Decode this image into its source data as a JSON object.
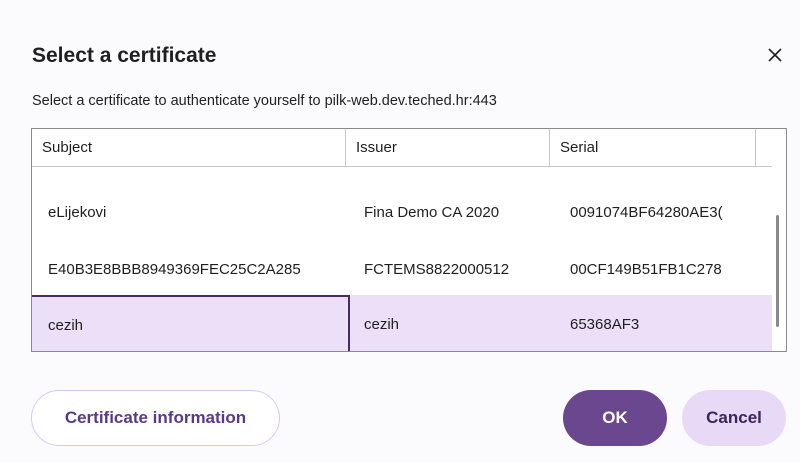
{
  "dialog": {
    "title": "Select a certificate",
    "subtitle": "Select a certificate to authenticate yourself to pilk-web.dev.teched.hr:443",
    "close_icon": "close-icon"
  },
  "table": {
    "columns": [
      "Subject",
      "Issuer",
      "Serial"
    ],
    "rows": [
      {
        "subject": "eLijekovi",
        "issuer": "Fina Demo CA 2020",
        "serial": "0091074BF64280AE3("
      },
      {
        "subject": "E40B3E8BBB8949369FEC25C2A285",
        "issuer": "FCTEMS8822000512",
        "serial": "00CF149B51FB1C278"
      },
      {
        "subject": "cezih",
        "issuer": "cezih",
        "serial": "65368AF3"
      }
    ],
    "selected_row": 2
  },
  "buttons": {
    "info_label": "Certificate information",
    "ok_label": "OK",
    "cancel_label": "Cancel"
  },
  "colors": {
    "accent": "#6b4790",
    "selected_row": "#ecdff8",
    "secondary_button": "#e8d9f7"
  }
}
